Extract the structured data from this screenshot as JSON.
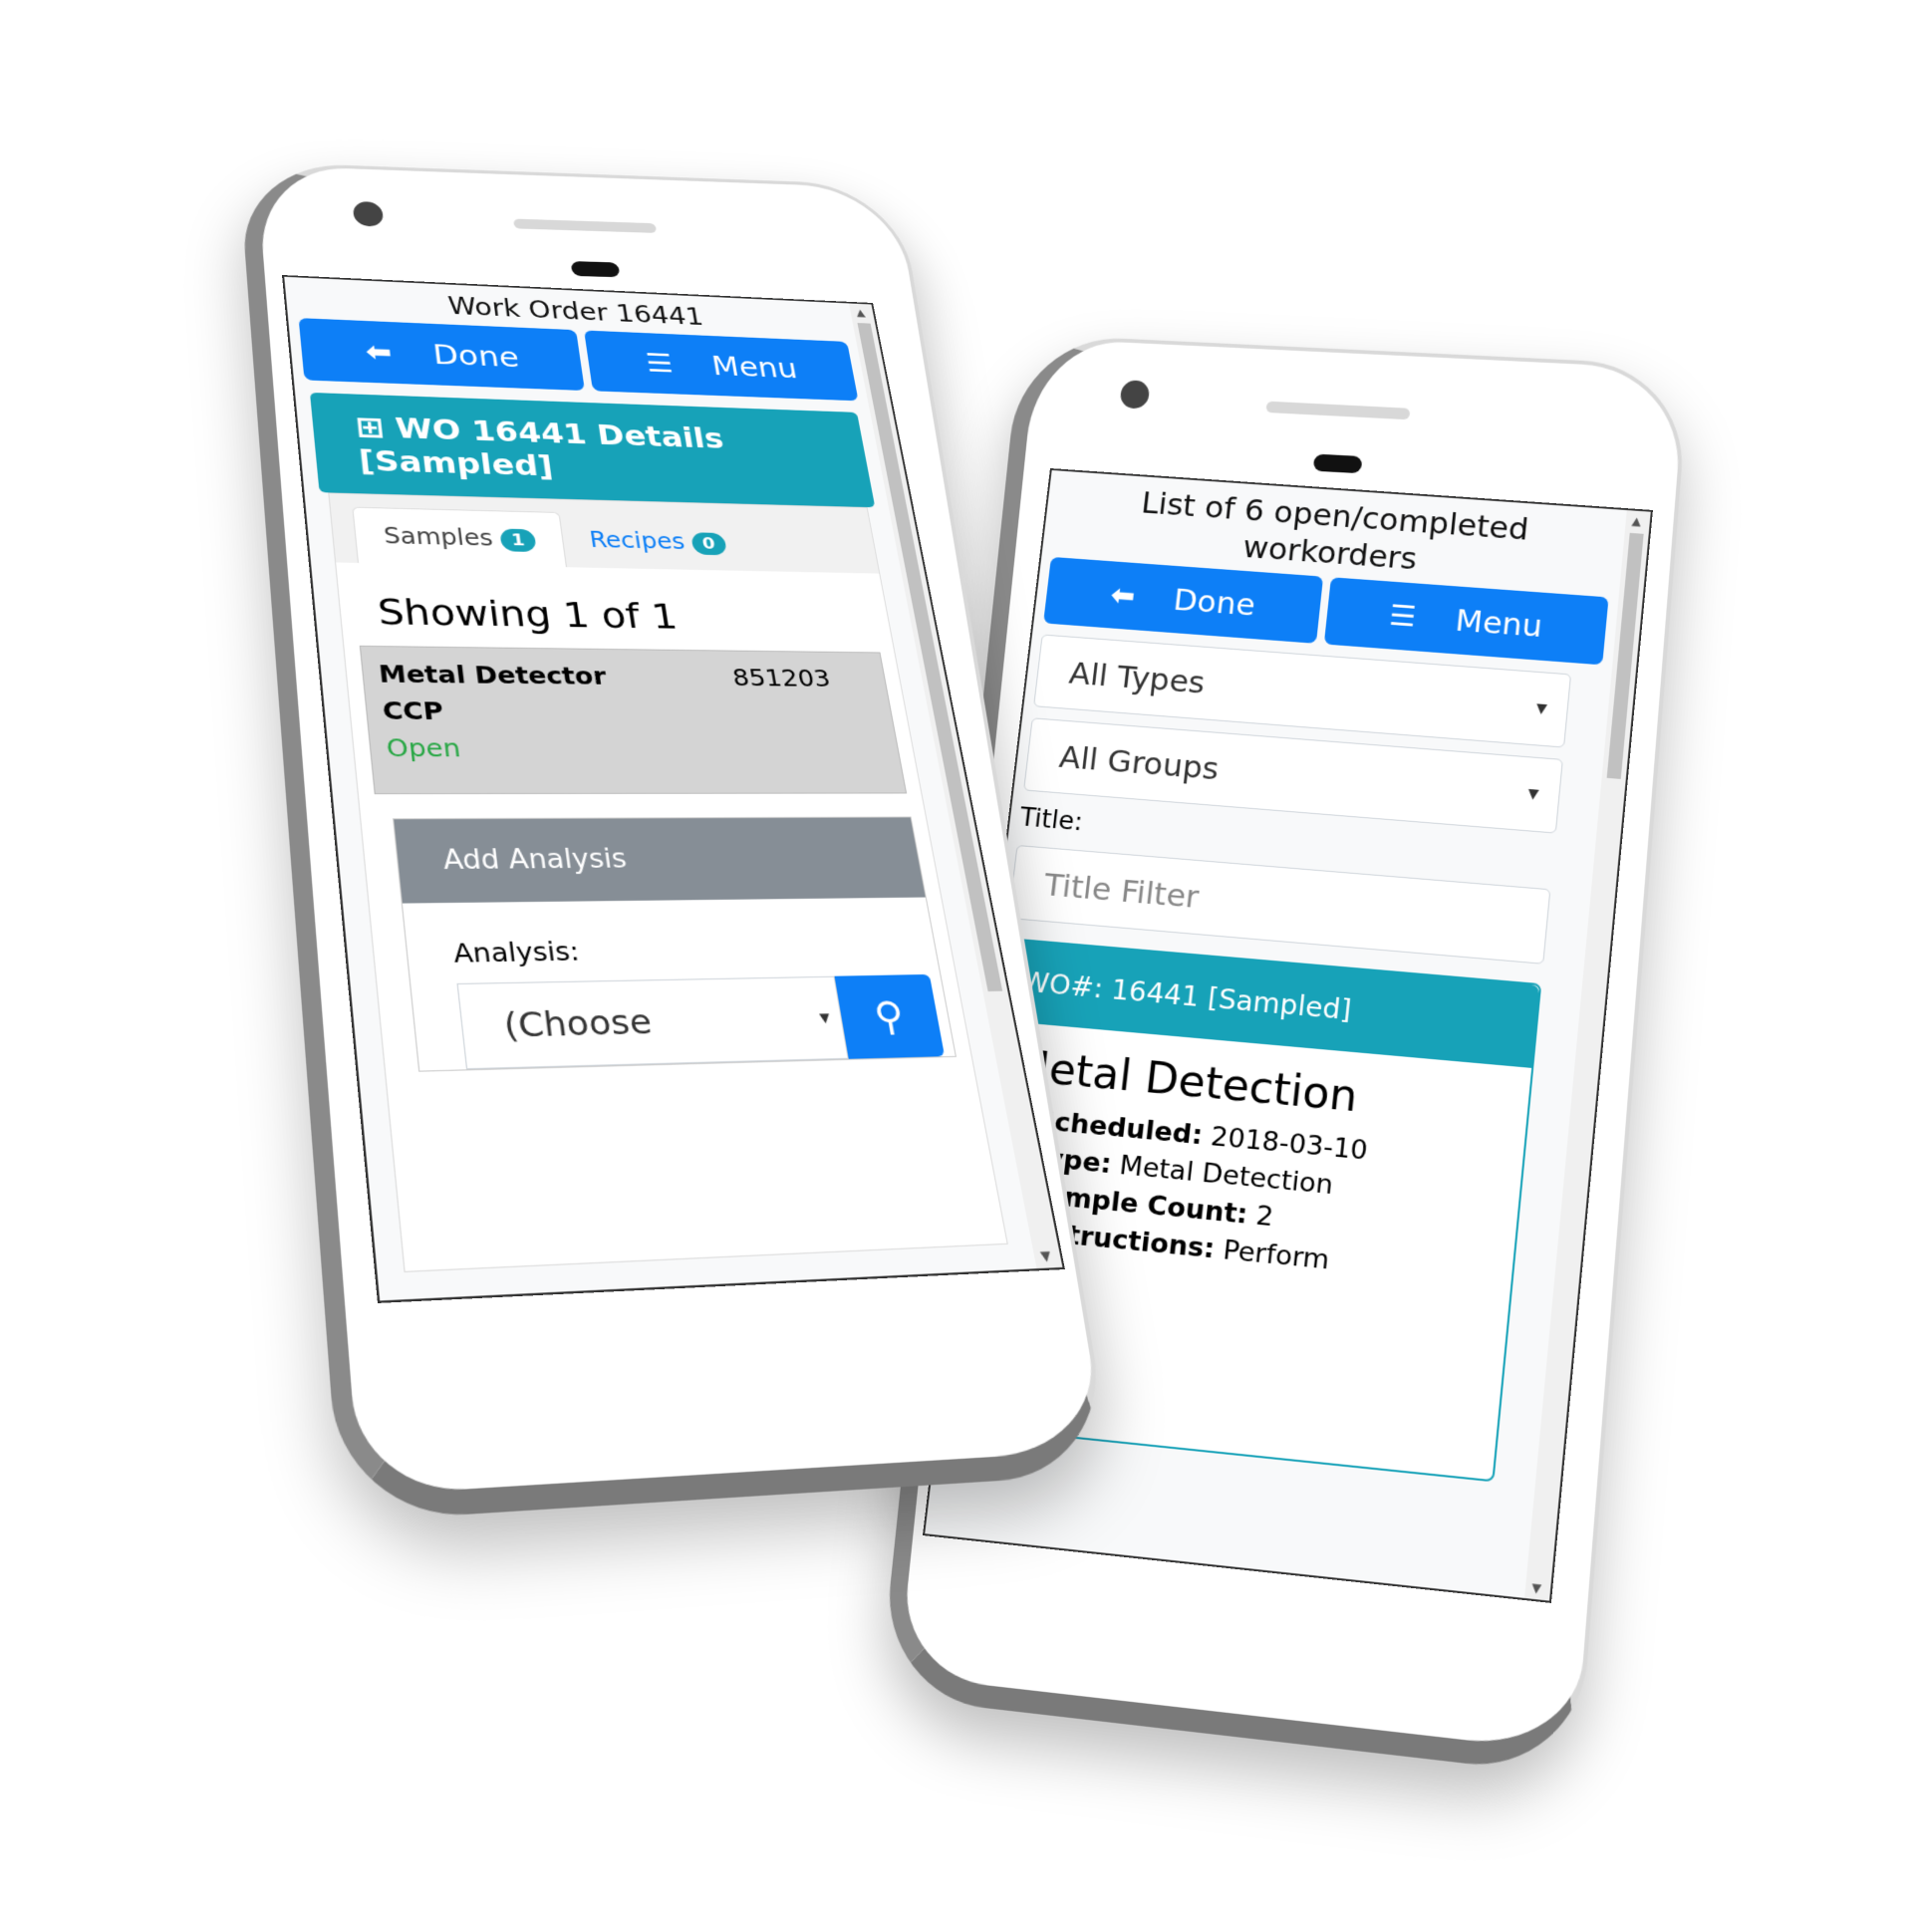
{
  "colors": {
    "primary": "#0d7ff7",
    "info": "#17a2b8",
    "secondary": "#868e96",
    "success": "#28a745"
  },
  "left_phone": {
    "title": "Work Order 16441",
    "done_button": {
      "icon": "arrow-left-icon",
      "label": "Done"
    },
    "menu_button": {
      "icon": "bars-icon",
      "label": "Menu"
    },
    "details_header": {
      "icon": "plus-square-icon",
      "label": "WO 16441 Details [Sampled]"
    },
    "tabs": [
      {
        "label": "Samples",
        "count": "1",
        "active": true
      },
      {
        "label": "Recipes",
        "count": "0",
        "active": false
      }
    ],
    "showing": "Showing 1 of 1",
    "sample": {
      "name": "Metal Detector",
      "id": "851203",
      "type": "CCP",
      "status": "Open"
    },
    "add_analysis": {
      "header": "Add Analysis",
      "label": "Analysis:",
      "select_value": "(Choose",
      "search_icon": "search-icon"
    }
  },
  "right_phone": {
    "title": "List of 6 open/completed workorders",
    "done_button": {
      "icon": "arrow-left-icon",
      "label": "Done"
    },
    "menu_button": {
      "icon": "bars-icon",
      "label": "Menu"
    },
    "type_select": "All Types",
    "group_select": "All Groups",
    "title_label": "Title:",
    "title_placeholder": "Title Filter",
    "workorder": {
      "header": "WO#: 16441 [Sampled]",
      "name": "Metal Detection",
      "fields": [
        {
          "label": "Scheduled:",
          "value": "2018-03-10"
        },
        {
          "label": "Type:",
          "value": "Metal Detection"
        },
        {
          "label": "Sample Count:",
          "value": "2"
        },
        {
          "label": "Instructions:",
          "value": "Perform"
        }
      ]
    }
  }
}
